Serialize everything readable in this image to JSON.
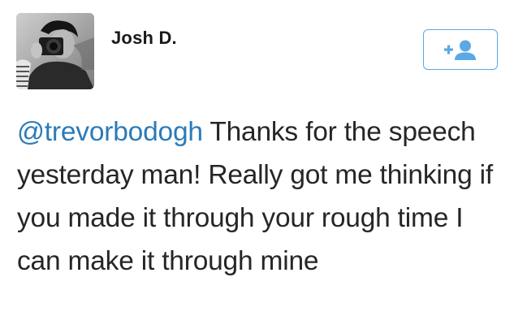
{
  "tweet": {
    "author": {
      "name": "Josh D."
    },
    "follow": {
      "icon": "follow-user-plus-icon",
      "accent": "#5aa9e6"
    },
    "text": {
      "mention": "@trevorbodogh",
      "body": " Thanks for the speech yesterday man! Really got me thinking if you made it through your rough time I can make it through mine"
    },
    "colors": {
      "mention": "#2b7bb9",
      "text": "#262626",
      "name": "#1a1a1a"
    }
  }
}
